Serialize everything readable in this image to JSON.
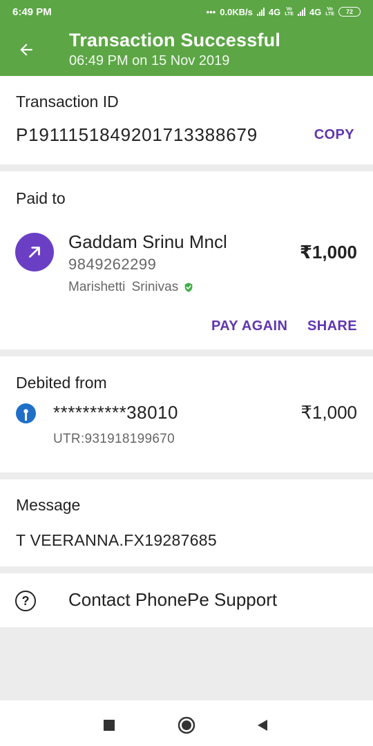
{
  "status_bar": {
    "time": "6:49 PM",
    "speed": "0.0KB/s",
    "net1": "4G",
    "net2": "4G",
    "volte": "Vo LTE",
    "battery": "72"
  },
  "header": {
    "title": "Transaction Successful",
    "subtitle": "06:49 PM on 15 Nov 2019",
    "back_icon": "arrow-left-icon"
  },
  "transaction": {
    "label": "Transaction ID",
    "id": "P1911151849201713388679",
    "copy_label": "COPY"
  },
  "paid_to": {
    "label": "Paid to",
    "name": "Gaddam Srinu Mncl",
    "phone": "9849262299",
    "bank_name": "Marishetti  Srinivas",
    "amount": "₹1,000",
    "pay_again_label": "PAY AGAIN",
    "share_label": "SHARE",
    "avatar_icon": "arrow-up-right-icon",
    "verified_icon": "verified-shield-icon"
  },
  "debited_from": {
    "label": "Debited from",
    "account": "**********38010",
    "amount": "₹1,000",
    "utr": "UTR:931918199670",
    "bank_icon": "bank-logo-icon"
  },
  "message": {
    "label": "Message",
    "text": "T VEERANNA.FX19287685"
  },
  "support": {
    "label": "Contact PhonePe Support",
    "icon": "help-circle-icon"
  },
  "colors": {
    "header_green": "#5ca645",
    "accent_purple": "#5f35b0",
    "avatar_purple": "#6b3fc4",
    "bank_blue": "#1f6fc9",
    "verified_green": "#3fae49"
  }
}
